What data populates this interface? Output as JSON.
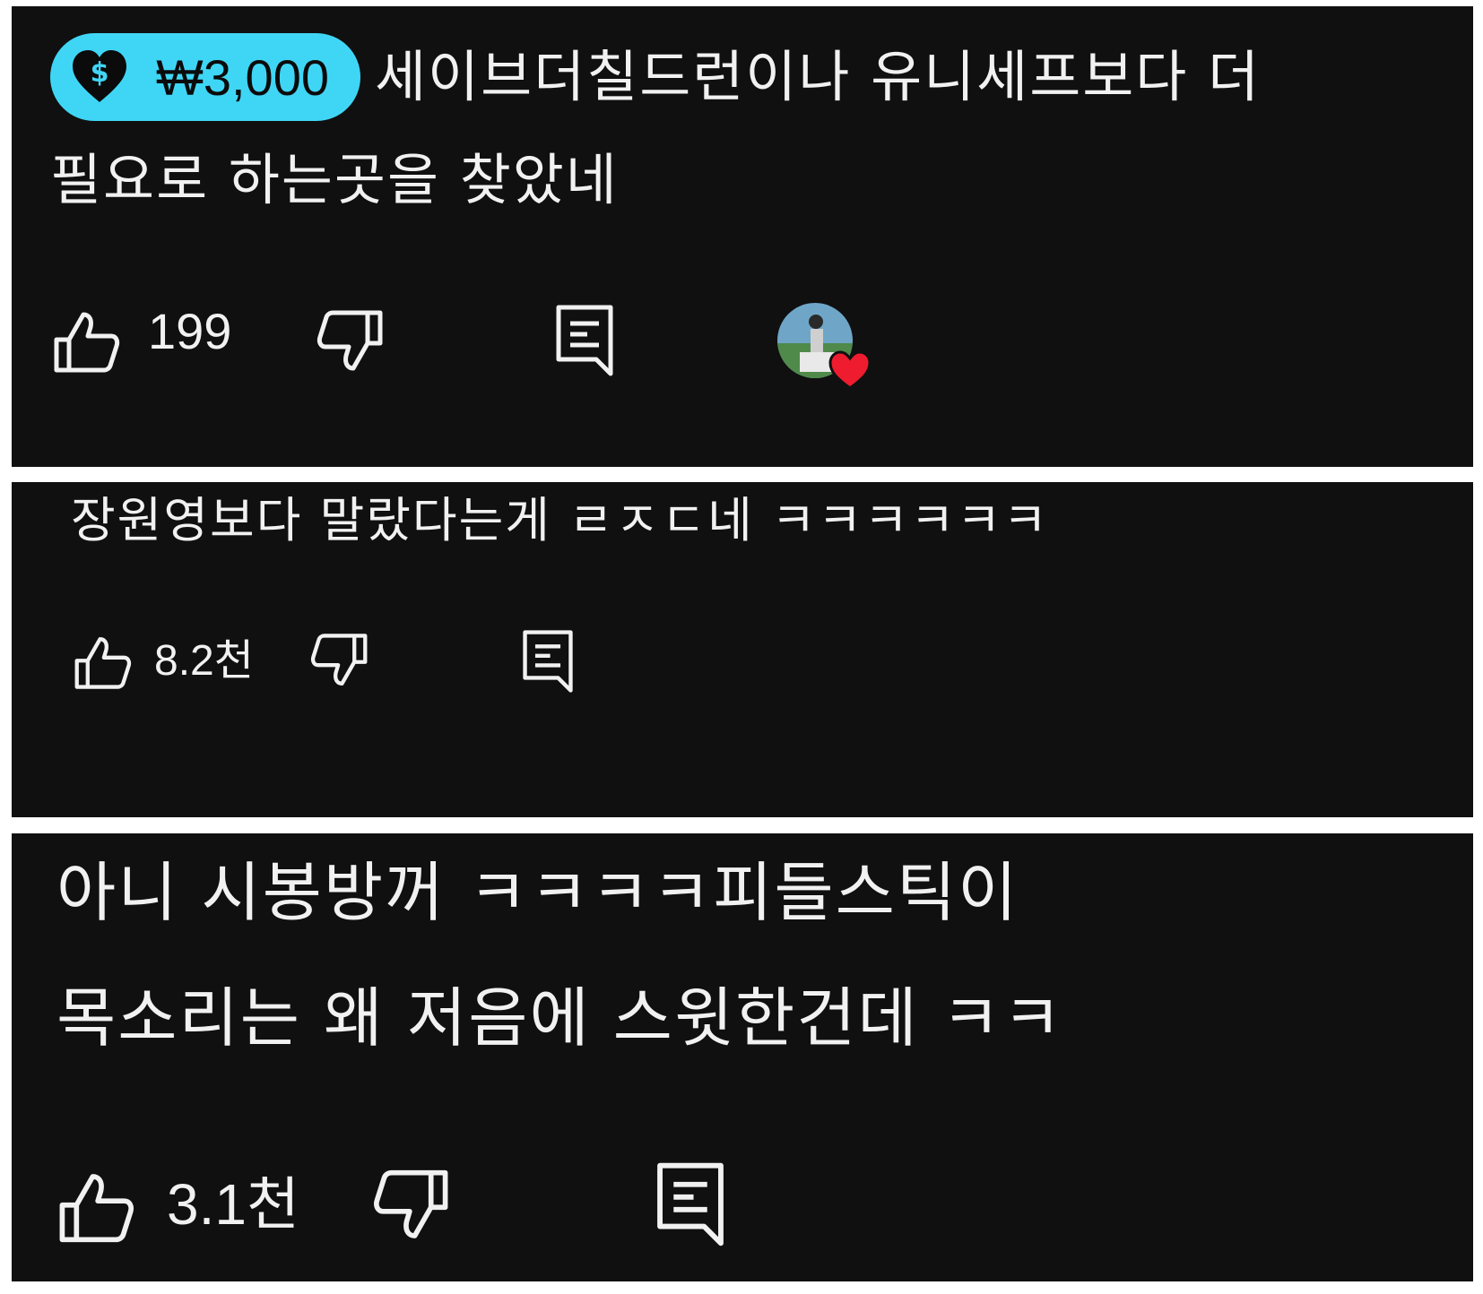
{
  "comments": [
    {
      "donation_amount": "₩3,000",
      "text_lines": [
        "세이브더칠드런이나 유니세프보다 더",
        "필요로 하는곳을 찾았네"
      ],
      "like_count": "199",
      "creator_heart": true
    },
    {
      "text_lines": [
        "장원영보다 말랐다는게 ㄹㅈㄷ네 ㅋㅋㅋㅋㅋㅋ"
      ],
      "like_count": "8.2천"
    },
    {
      "text_lines": [
        "아니 시봉방꺼 ㅋㅋㅋㅋ피들스틱이",
        "목소리는 왜 저음에 스윗한건데 ㅋㅋ"
      ],
      "like_count": "3.1천"
    }
  ],
  "colors": {
    "panel_bg": "#101010",
    "chip_bg": "#3fd6f6",
    "heart": "#ee1c2e",
    "text": "#f1f1f1"
  },
  "icons": [
    "dollar-heart-icon",
    "thumbs-up-icon",
    "thumbs-down-icon",
    "reply-icon",
    "heart-icon"
  ]
}
